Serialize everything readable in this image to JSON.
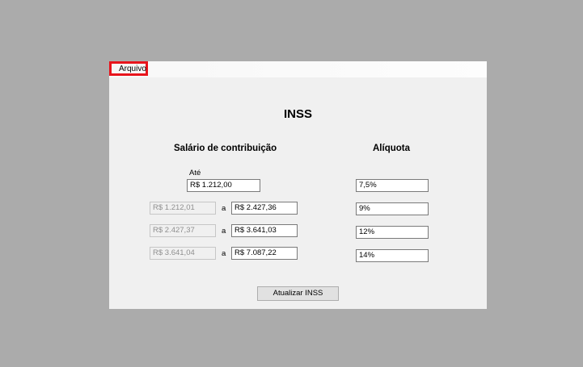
{
  "menu": {
    "file_label": "Arquivo"
  },
  "title": "INSS",
  "headers": {
    "salary": "Salário de contribuição",
    "rate": "Alíquota"
  },
  "first_band": {
    "upto_label": "Até",
    "upper": "R$ 1.212,00",
    "rate": "7,5%"
  },
  "bands": [
    {
      "lower": "R$ 1.212,01",
      "sep": "a",
      "upper": "R$ 2.427,36",
      "rate": "9%"
    },
    {
      "lower": "R$ 2.427,37",
      "sep": "a",
      "upper": "R$ 3.641,03",
      "rate": "12%"
    },
    {
      "lower": "R$ 3.641,04",
      "sep": "a",
      "upper": "R$ 7.087,22",
      "rate": "14%"
    }
  ],
  "update_button": "Atualizar INSS",
  "colors": {
    "desktop": "#ababab",
    "window": "#f0f0f0",
    "highlight": "#e8141c"
  }
}
